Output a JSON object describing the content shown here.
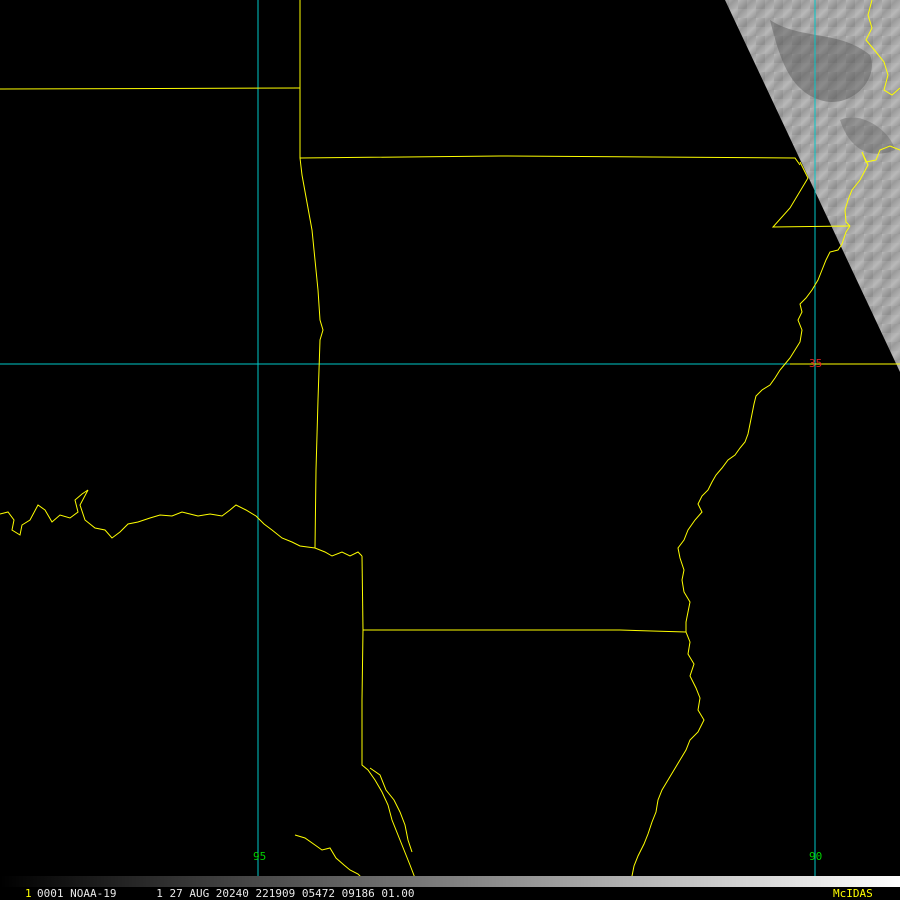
{
  "map": {
    "grid_labels": {
      "lon_95": "95",
      "lon_90": "90",
      "lat_35": "35"
    },
    "colors": {
      "background": "#000000",
      "borders": "#ffff00",
      "grid": "#00c8c8",
      "lon_label": "#00d000",
      "lat_label": "#e02020",
      "status_text": "#e8e8e8",
      "logo": "#ffff00"
    }
  },
  "status_bar": {
    "frame_index": "1",
    "text": "0001 NOAA-19      1 27 AUG 20240 221909 05472 09186 01.00",
    "logo": "McIDAS"
  }
}
